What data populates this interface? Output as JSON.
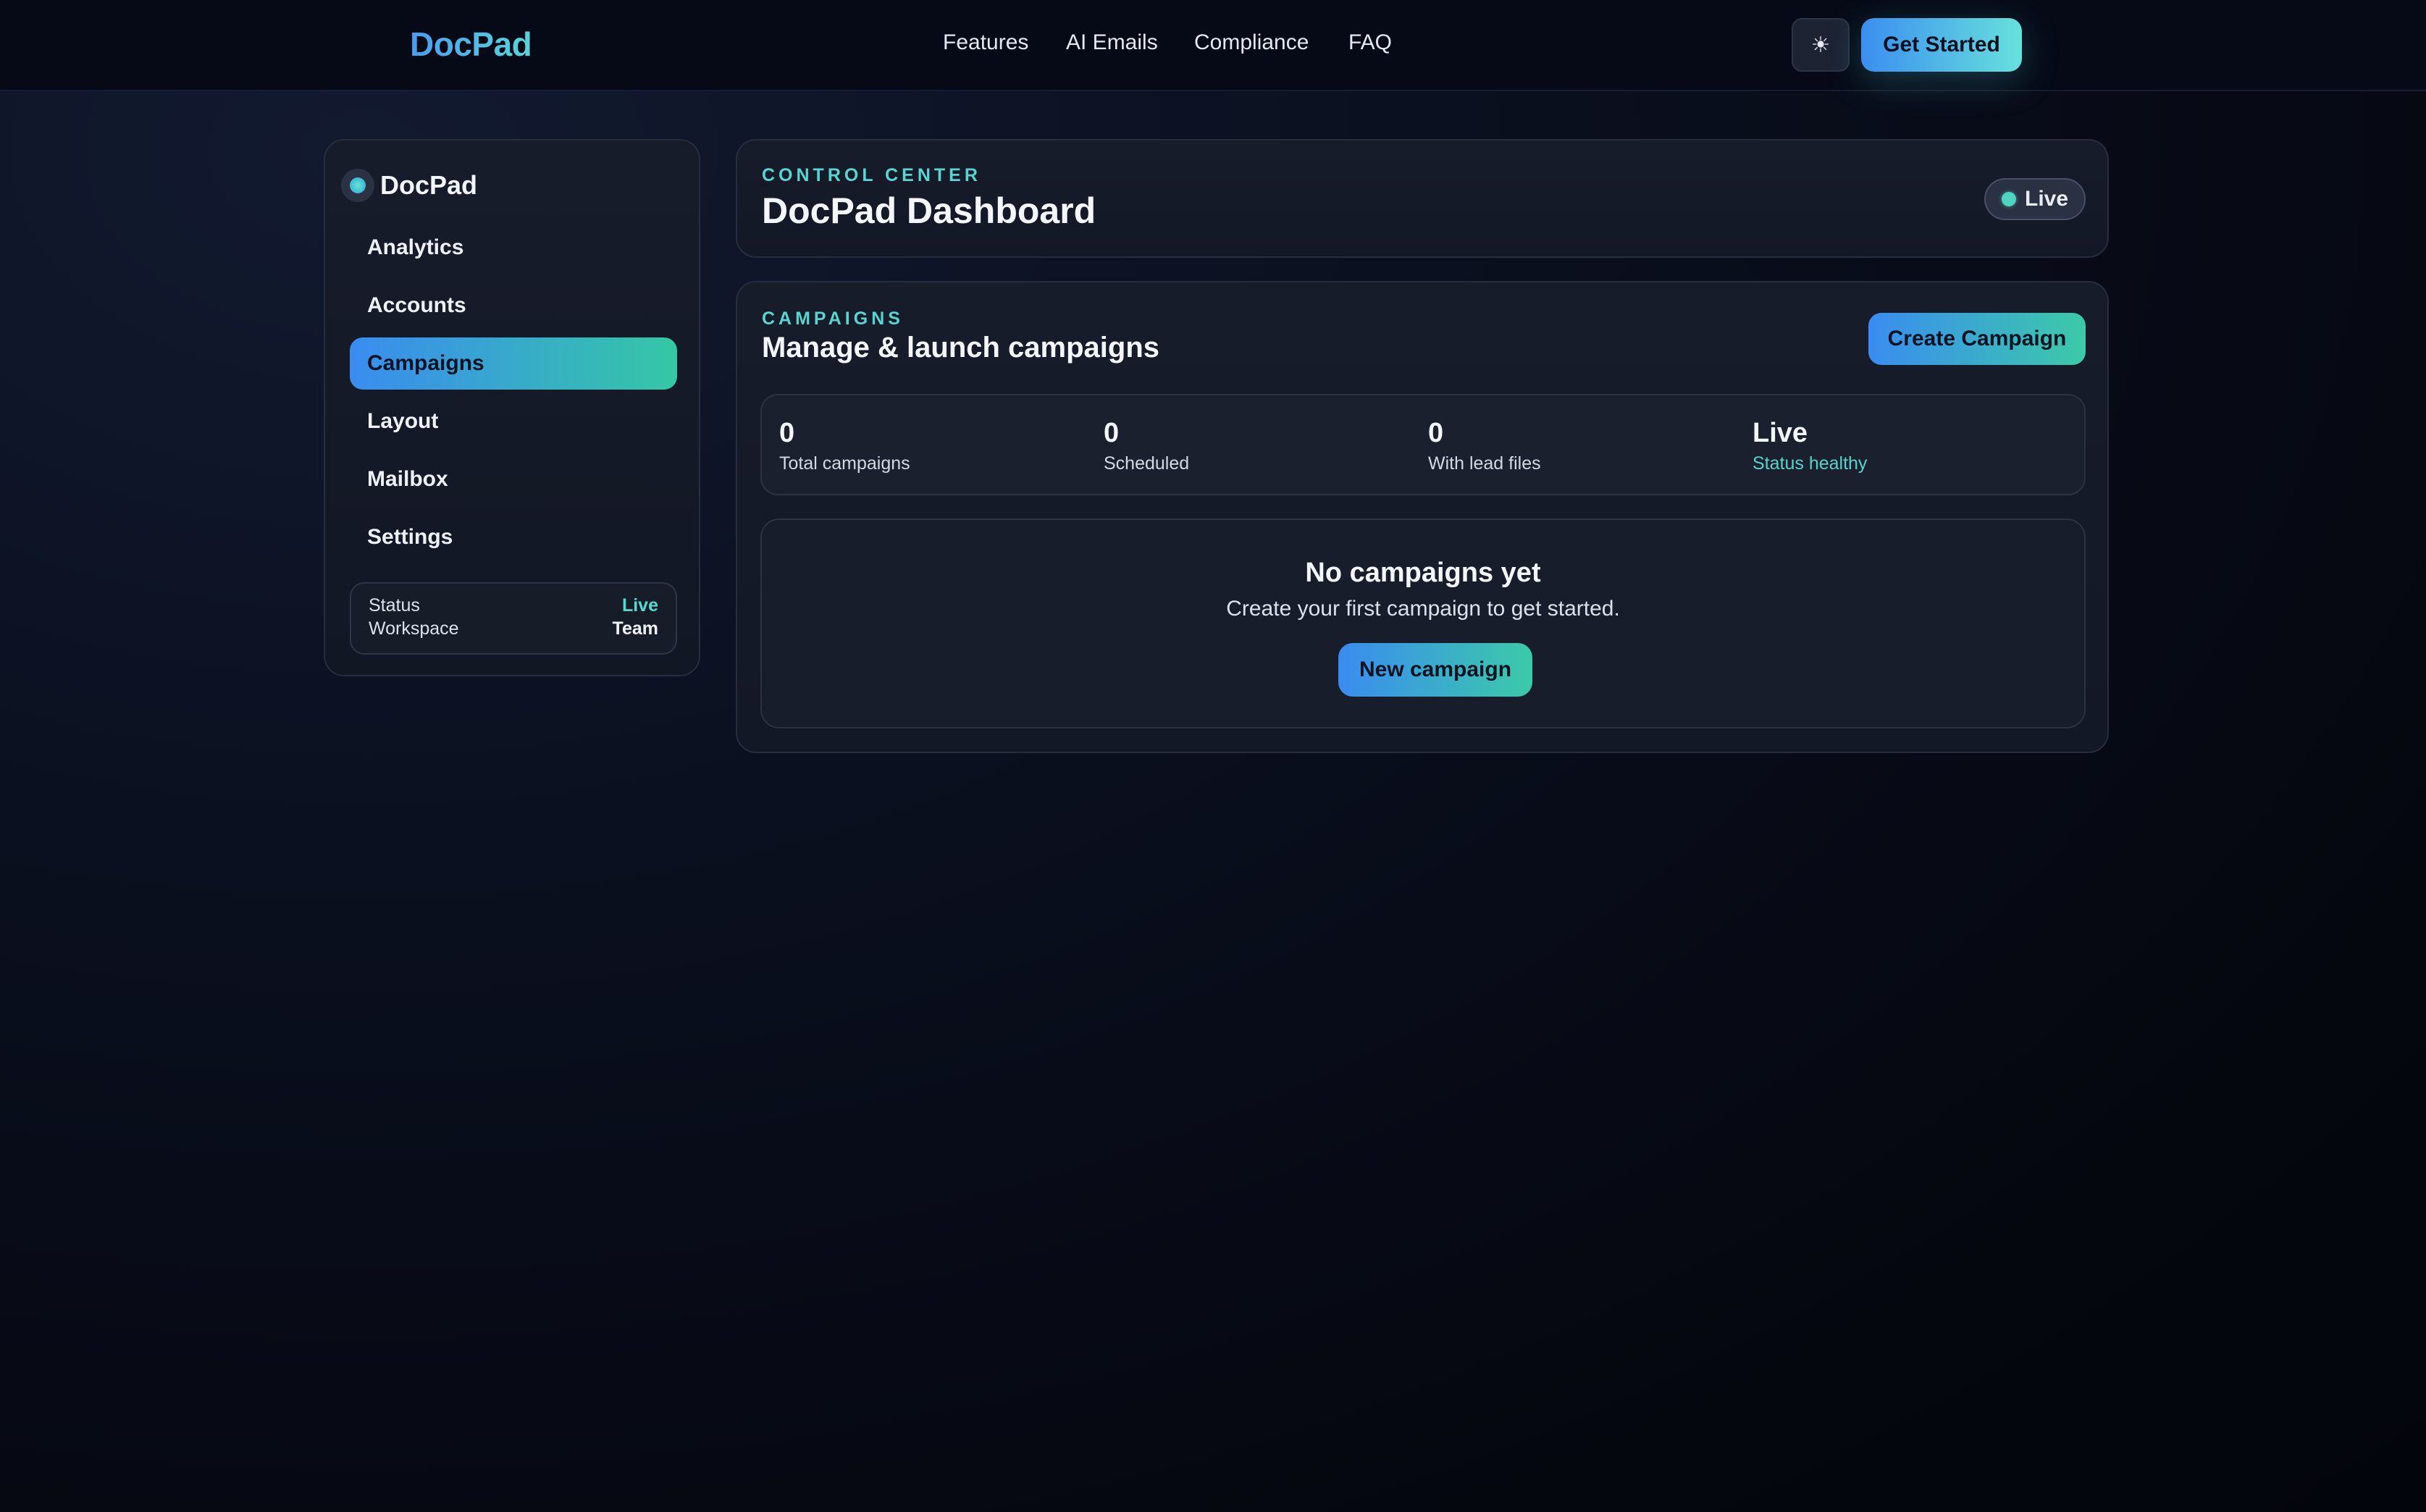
{
  "nav": {
    "brand": "DocPad",
    "links": [
      "Features",
      "AI Emails",
      "Compliance",
      "FAQ"
    ],
    "theme_icon": "sun-icon",
    "theme_glyph": "☀",
    "get_started_label": "Get Started"
  },
  "sidebar": {
    "brand": "DocPad",
    "items": [
      {
        "label": "Analytics",
        "active": false
      },
      {
        "label": "Accounts",
        "active": false
      },
      {
        "label": "Campaigns",
        "active": true
      },
      {
        "label": "Layout",
        "active": false
      },
      {
        "label": "Mailbox",
        "active": false
      },
      {
        "label": "Settings",
        "active": false
      }
    ],
    "status": {
      "status_label": "Status",
      "status_value": "Live",
      "workspace_label": "Workspace",
      "workspace_value": "Team"
    }
  },
  "header": {
    "eyebrow": "CONTROL CENTER",
    "title": "DocPad Dashboard",
    "live_label": "Live"
  },
  "campaigns": {
    "eyebrow": "CAMPAIGNS",
    "title": "Manage & launch campaigns",
    "create_label": "Create Campaign",
    "stats": [
      {
        "value": "0",
        "label": "Total campaigns"
      },
      {
        "value": "0",
        "label": "Scheduled"
      },
      {
        "value": "0",
        "label": "With lead files"
      },
      {
        "value": "Live",
        "label": "Status healthy"
      }
    ],
    "empty": {
      "title": "No campaigns yet",
      "subtitle": "Create your first campaign to get started.",
      "button_label": "New campaign"
    }
  },
  "colors": {
    "accent_blue": "#3a8cf0",
    "accent_teal": "#3ccaa8",
    "live_teal": "#5ad8cf",
    "background": "#05070f"
  }
}
